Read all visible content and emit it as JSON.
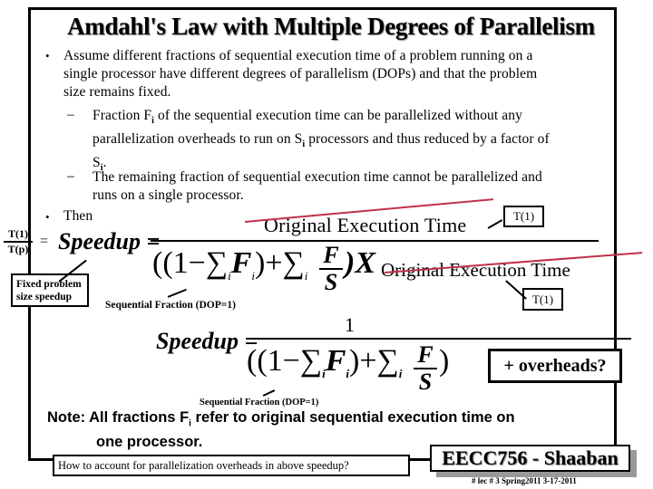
{
  "slide": {
    "title": "Amdahl's Law with Multiple Degrees of Parallelism",
    "bullets": [
      {
        "text_line1": "Assume different fractions of sequential execution time of a problem running on a",
        "text_line2": "single processor  have different degrees of parallelism (DOPs) and that the problem",
        "text_line3": "size remains fixed."
      },
      {
        "text": "Then"
      }
    ],
    "sub_bullets": [
      {
        "part1": "Fraction  F",
        "sub1": "i",
        "part2": " of the sequential execution time can be parallelized without any",
        "line2a": "parallelization overheads to run on S",
        "sub2": "i",
        "line2b": " processors and thus reduced by a factor of",
        "line3a": "S",
        "sub3": "i",
        "line3b": "."
      },
      {
        "line1": "The remaining fraction of sequential execution time cannot be parallelized and",
        "line2": "runs on a single processor."
      }
    ],
    "bullet_glyph": "•",
    "dash_glyph": "–"
  },
  "equation1": {
    "lhs_num": "T(1)",
    "lhs_den": "T(p)",
    "equals": "=",
    "speedup_label": "Speedup =",
    "numerator": "Original  Execution   Time",
    "denominator_prefix": "((1−∑",
    "sub_i": "i",
    "F": "F",
    "plus_sum": ")+∑",
    "frac_num": "F",
    "frac_den": "S",
    "close_x": ")X",
    "denominator_suffix": "Original  Execution  Time",
    "t1_top": "T(1)",
    "t1_bottom": "T(1)",
    "fixed_box_line1": "Fixed problem",
    "fixed_box_line2": "size speedup",
    "seq_fraction_label": "Sequential Fraction (DOP=1)"
  },
  "equation2": {
    "speedup_label": "Speedup =",
    "numerator": "1",
    "denominator_prefix": "((1−∑",
    "sub_i": "i",
    "F": "F",
    "plus_sum": ")+∑",
    "frac_num": "F",
    "frac_den": "S",
    "close": ")",
    "overheads_box": "+ overheads?",
    "seq_fraction_label": "Sequential Fraction (DOP=1)"
  },
  "note": {
    "line1a": "Note:  All fractions F",
    "sub": "i",
    "line1b": " refer to original sequential execution time on",
    "line2": "one processor."
  },
  "footer": {
    "question": "How to account for parallelization overheads in above speedup?",
    "brand": "EECC756 - Shaaban",
    "meta": "#  lec # 3   Spring2011   3-17-2011"
  },
  "colors": {
    "strike": "#c0304a",
    "shadow": "#999999"
  }
}
